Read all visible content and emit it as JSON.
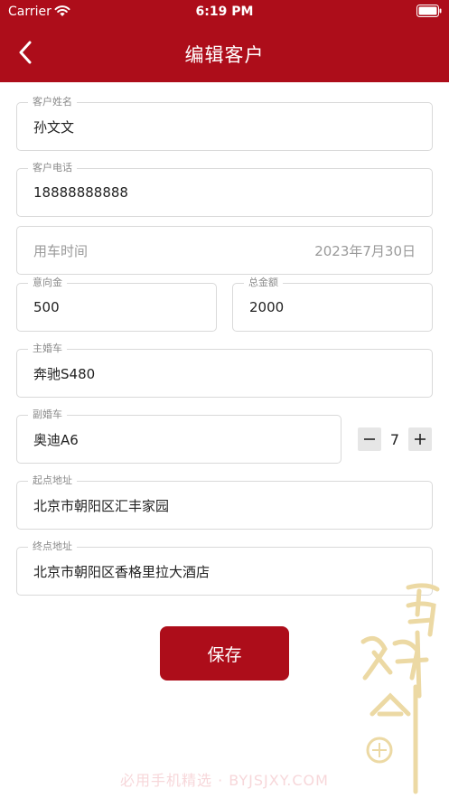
{
  "status_bar": {
    "carrier": "Carrier",
    "time": "6:19 PM"
  },
  "header": {
    "title": "编辑客户"
  },
  "form": {
    "customer_name": {
      "label": "客户姓名",
      "value": "孙文文"
    },
    "customer_phone": {
      "label": "客户电话",
      "value": "18888888888"
    },
    "use_time": {
      "placeholder": "用车时间",
      "value": "2023年7月30日"
    },
    "deposit": {
      "label": "意向金",
      "value": "500"
    },
    "total_amount": {
      "label": "总金额",
      "value": "2000"
    },
    "main_car": {
      "label": "主婚车",
      "value": "奔驰S480"
    },
    "secondary_car": {
      "label": "副婚车",
      "value": "奥迪A6",
      "quantity": "7"
    },
    "start_address": {
      "label": "起点地址",
      "value": "北京市朝阳区汇丰家园"
    },
    "end_address": {
      "label": "终点地址",
      "value": "北京市朝阳区香格里拉大酒店"
    }
  },
  "actions": {
    "save_label": "保存"
  },
  "watermark": {
    "text": "必用手机精选 · BYJSJXY.COM"
  },
  "colors": {
    "brand": "#ad0d1a",
    "border": "#d9d9d9",
    "label": "#8a8a8a",
    "stepper_bg": "#e6e6e6"
  },
  "icons": {
    "back": "chevron-left-icon",
    "wifi": "wifi-icon",
    "battery": "battery-icon",
    "minus": "minus-icon",
    "plus": "plus-icon"
  }
}
